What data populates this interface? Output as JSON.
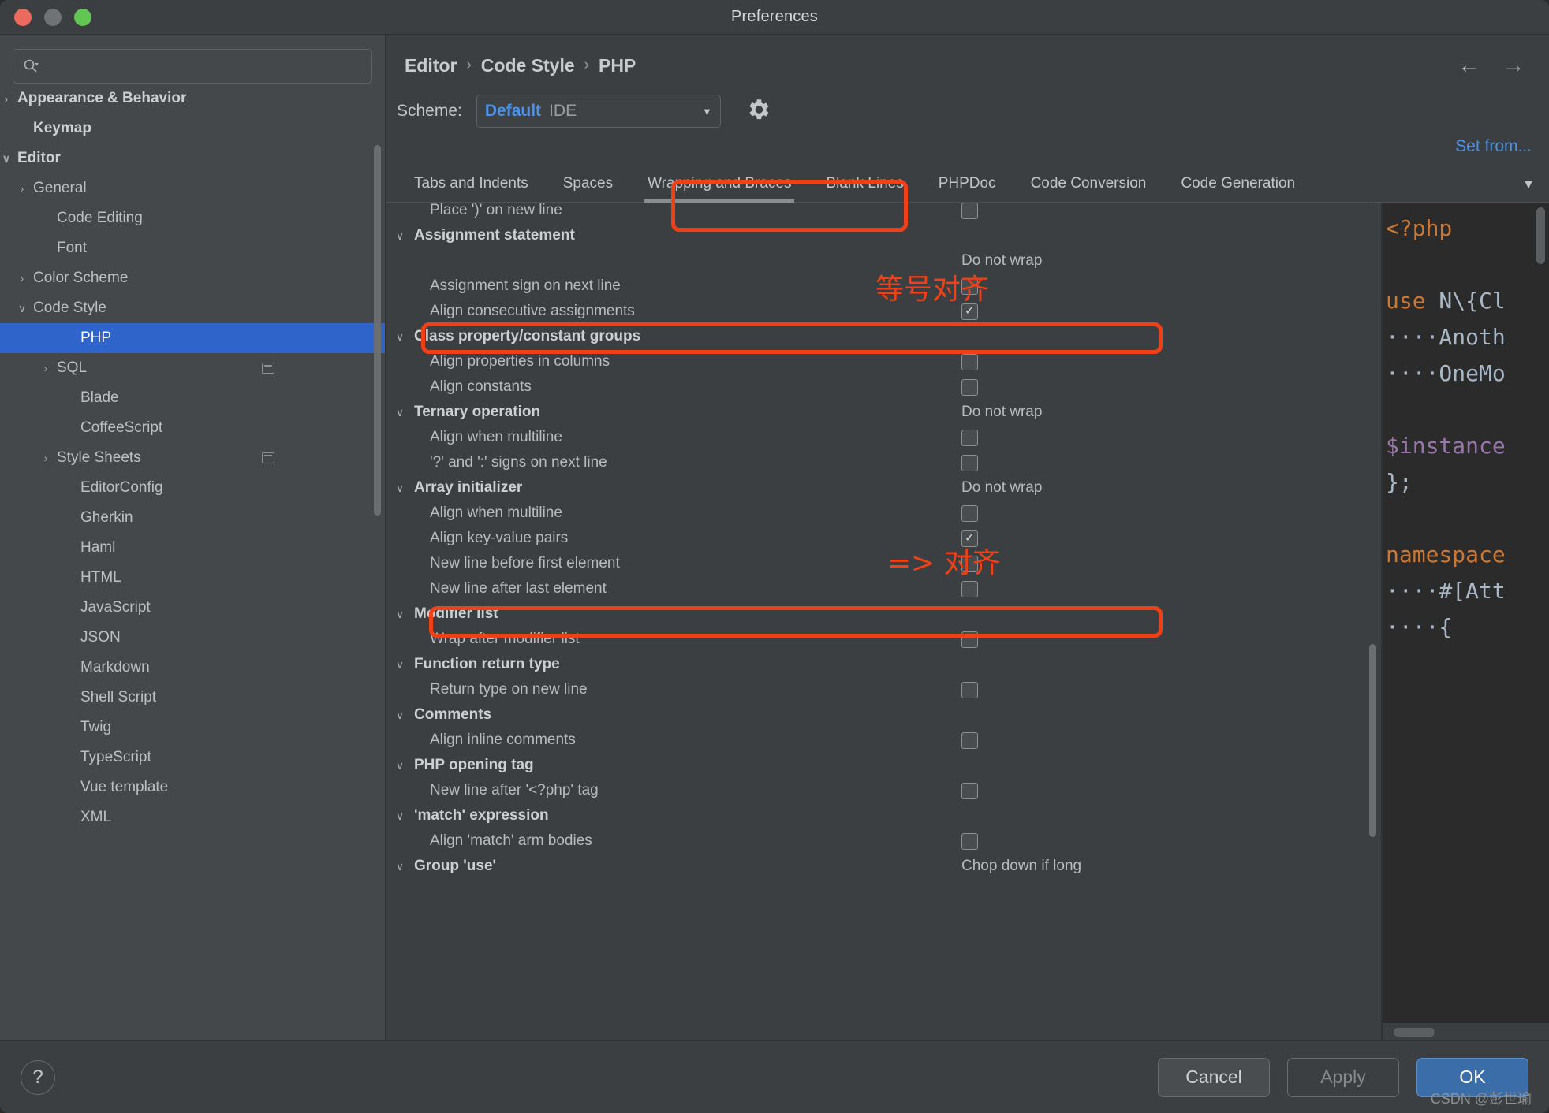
{
  "window": {
    "title": "Preferences"
  },
  "search": {
    "value": "",
    "placeholder": ""
  },
  "sidebar": {
    "items": [
      {
        "label": "Appearance & Behavior",
        "arrow": "›",
        "indent": 0,
        "bold": true,
        "selected": false,
        "badge": false
      },
      {
        "label": "Keymap",
        "arrow": "",
        "indent": 1,
        "bold": true,
        "selected": false,
        "badge": false
      },
      {
        "label": "Editor",
        "arrow": "⌄",
        "indent": 0,
        "bold": true,
        "selected": false,
        "badge": false
      },
      {
        "label": "General",
        "arrow": "›",
        "indent": 1,
        "bold": false,
        "selected": false,
        "badge": false
      },
      {
        "label": "Code Editing",
        "arrow": "",
        "indent": 2,
        "bold": false,
        "selected": false,
        "badge": false
      },
      {
        "label": "Font",
        "arrow": "",
        "indent": 2,
        "bold": false,
        "selected": false,
        "badge": false
      },
      {
        "label": "Color Scheme",
        "arrow": "›",
        "indent": 1,
        "bold": false,
        "selected": false,
        "badge": false
      },
      {
        "label": "Code Style",
        "arrow": "⌄",
        "indent": 1,
        "bold": false,
        "selected": false,
        "badge": false
      },
      {
        "label": "PHP",
        "arrow": "",
        "indent": 3,
        "bold": false,
        "selected": true,
        "badge": false
      },
      {
        "label": "SQL",
        "arrow": "›",
        "indent": 2,
        "bold": false,
        "selected": false,
        "badge": true
      },
      {
        "label": "Blade",
        "arrow": "",
        "indent": 3,
        "bold": false,
        "selected": false,
        "badge": false
      },
      {
        "label": "CoffeeScript",
        "arrow": "",
        "indent": 3,
        "bold": false,
        "selected": false,
        "badge": false
      },
      {
        "label": "Style Sheets",
        "arrow": "›",
        "indent": 2,
        "bold": false,
        "selected": false,
        "badge": true
      },
      {
        "label": "EditorConfig",
        "arrow": "",
        "indent": 3,
        "bold": false,
        "selected": false,
        "badge": false
      },
      {
        "label": "Gherkin",
        "arrow": "",
        "indent": 3,
        "bold": false,
        "selected": false,
        "badge": false
      },
      {
        "label": "Haml",
        "arrow": "",
        "indent": 3,
        "bold": false,
        "selected": false,
        "badge": false
      },
      {
        "label": "HTML",
        "arrow": "",
        "indent": 3,
        "bold": false,
        "selected": false,
        "badge": false
      },
      {
        "label": "JavaScript",
        "arrow": "",
        "indent": 3,
        "bold": false,
        "selected": false,
        "badge": false
      },
      {
        "label": "JSON",
        "arrow": "",
        "indent": 3,
        "bold": false,
        "selected": false,
        "badge": false
      },
      {
        "label": "Markdown",
        "arrow": "",
        "indent": 3,
        "bold": false,
        "selected": false,
        "badge": false
      },
      {
        "label": "Shell Script",
        "arrow": "",
        "indent": 3,
        "bold": false,
        "selected": false,
        "badge": false
      },
      {
        "label": "Twig",
        "arrow": "",
        "indent": 3,
        "bold": false,
        "selected": false,
        "badge": false
      },
      {
        "label": "TypeScript",
        "arrow": "",
        "indent": 3,
        "bold": false,
        "selected": false,
        "badge": false
      },
      {
        "label": "Vue template",
        "arrow": "",
        "indent": 3,
        "bold": false,
        "selected": false,
        "badge": false
      },
      {
        "label": "XML",
        "arrow": "",
        "indent": 3,
        "bold": false,
        "selected": false,
        "badge": false
      }
    ]
  },
  "breadcrumb": {
    "parts": [
      "Editor",
      "Code Style",
      "PHP"
    ],
    "separator": "›"
  },
  "scheme": {
    "label": "Scheme:",
    "value": "Default",
    "value_suffix": "IDE",
    "chevron": "▼",
    "set_from": "Set from..."
  },
  "tabs": {
    "items": [
      {
        "label": "Tabs and Indents",
        "active": false
      },
      {
        "label": "Spaces",
        "active": false
      },
      {
        "label": "Wrapping and Braces",
        "active": true
      },
      {
        "label": "Blank Lines",
        "active": false
      },
      {
        "label": "PHPDoc",
        "active": false
      },
      {
        "label": "Code Conversion",
        "active": false
      },
      {
        "label": "Code Generation",
        "active": false
      }
    ],
    "overflow": "▼"
  },
  "settings": {
    "rows": [
      {
        "label": "Place ')' on new line",
        "type": "option",
        "control": "checkbox",
        "checked": false
      },
      {
        "label": "Assignment statement",
        "type": "group",
        "control": "none"
      },
      {
        "label": "",
        "type": "wraptext",
        "control": "text",
        "text": "Do not wrap"
      },
      {
        "label": "Assignment sign on next line",
        "type": "option",
        "control": "checkbox",
        "checked": false
      },
      {
        "label": "Align consecutive assignments",
        "type": "option",
        "control": "checkbox",
        "checked": true
      },
      {
        "label": "Class property/constant groups",
        "type": "group",
        "control": "none"
      },
      {
        "label": "Align properties in columns",
        "type": "option",
        "control": "checkbox",
        "checked": false
      },
      {
        "label": "Align constants",
        "type": "option",
        "control": "checkbox",
        "checked": false
      },
      {
        "label": "Ternary operation",
        "type": "group",
        "control": "text",
        "text": "Do not wrap"
      },
      {
        "label": "Align when multiline",
        "type": "option",
        "control": "checkbox",
        "checked": false
      },
      {
        "label": "'?' and ':' signs on next line",
        "type": "option",
        "control": "checkbox",
        "checked": false
      },
      {
        "label": "Array initializer",
        "type": "group",
        "control": "text",
        "text": "Do not wrap"
      },
      {
        "label": "Align when multiline",
        "type": "option",
        "control": "checkbox",
        "checked": false
      },
      {
        "label": "Align key-value pairs",
        "type": "option",
        "control": "checkbox",
        "checked": true
      },
      {
        "label": "New line before first element",
        "type": "option",
        "control": "checkbox",
        "checked": false
      },
      {
        "label": "New line after last element",
        "type": "option",
        "control": "checkbox",
        "checked": false
      },
      {
        "label": "Modifier list",
        "type": "group",
        "control": "none"
      },
      {
        "label": "Wrap after modifier list",
        "type": "option",
        "control": "checkbox",
        "checked": false
      },
      {
        "label": "Function return type",
        "type": "group",
        "control": "none"
      },
      {
        "label": "Return type on new line",
        "type": "option",
        "control": "checkbox",
        "checked": false
      },
      {
        "label": "Comments",
        "type": "group",
        "control": "none"
      },
      {
        "label": "Align inline comments",
        "type": "option",
        "control": "checkbox",
        "checked": false
      },
      {
        "label": "PHP opening tag",
        "type": "group",
        "control": "none"
      },
      {
        "label": "New line after '<?php' tag",
        "type": "option",
        "control": "checkbox",
        "checked": false
      },
      {
        "label": "'match' expression",
        "type": "group",
        "control": "none"
      },
      {
        "label": "Align 'match' arm bodies",
        "type": "option",
        "control": "checkbox",
        "checked": false
      },
      {
        "label": "Group 'use'",
        "type": "group",
        "control": "text",
        "text": "Chop down if long"
      }
    ]
  },
  "preview": {
    "lines": [
      {
        "text": "<?php",
        "cls": "kw"
      },
      {
        "text": "",
        "cls": ""
      },
      {
        "text": "use N\\{Cl",
        "cls": "kw-lead"
      },
      {
        "text": "····Anoth",
        "cls": ""
      },
      {
        "text": "····OneMo",
        "cls": ""
      },
      {
        "text": "",
        "cls": ""
      },
      {
        "text": "$instance",
        "cls": "var"
      },
      {
        "text": "};",
        "cls": ""
      },
      {
        "text": "",
        "cls": ""
      },
      {
        "text": "namespace",
        "cls": "kw"
      },
      {
        "text": "····#[Att",
        "cls": ""
      },
      {
        "text": "····{",
        "cls": ""
      }
    ]
  },
  "footer": {
    "help": "?",
    "cancel": "Cancel",
    "apply": "Apply",
    "ok": "OK",
    "watermark": "CSDN @彭世瑜"
  },
  "annotations": {
    "equals_align": "等号对齐",
    "arrow_align": "=> 对齐"
  },
  "colors": {
    "accent_blue": "#4b92e8",
    "selection_blue": "#2f65ca",
    "annotation_red": "#f04018",
    "ok_button": "#3b6ea8"
  }
}
